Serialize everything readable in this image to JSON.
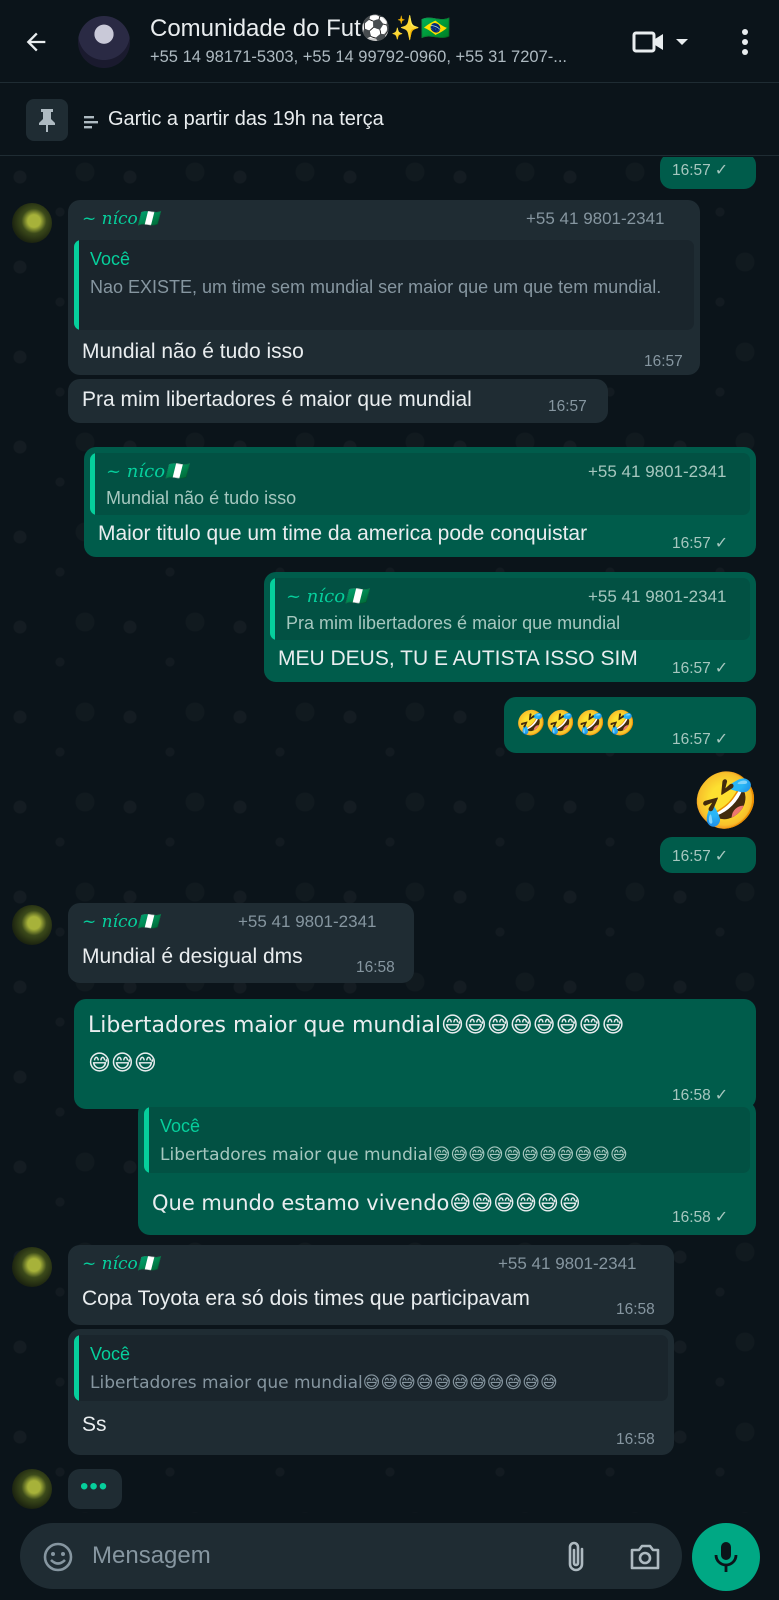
{
  "header": {
    "title": "Comunidade do Fut⚽✨🇧🇷",
    "subtitle": "+55 14 98171-5303, +55 14 99792-0960, +55 31 7207-..."
  },
  "pinned": {
    "text": "Gartic a partir das 19h na terça"
  },
  "messages": [
    {
      "time": "16:57"
    },
    {
      "sender": "~ níco🇳🇬",
      "phone": "+55 41 9801-2341",
      "quote_name": "Você",
      "quote_text": "Nao EXISTE, um time sem mundial ser maior que um que tem mundial.",
      "text": "Mundial não é tudo isso",
      "time": "16:57"
    },
    {
      "text": "Pra mim libertadores é maior que mundial",
      "time": "16:57"
    },
    {
      "quote_name": "~ níco🇳🇬",
      "quote_phone": "+55 41 9801-2341",
      "quote_text": "Mundial não é tudo isso",
      "text": "Maior titulo que um time da america pode conquistar",
      "time": "16:57"
    },
    {
      "quote_name": "~ níco🇳🇬",
      "quote_phone": "+55 41 9801-2341",
      "quote_text": "Pra mim libertadores é maior que mundial",
      "text": "MEU DEUS, TU E AUTISTA ISSO SIM",
      "time": "16:57"
    },
    {
      "text": "🤣🤣🤣🤣",
      "time": "16:57"
    },
    {
      "text": "🤣",
      "time": "16:57"
    },
    {
      "sender": "~ níco🇳🇬",
      "phone": "+55 41 9801-2341",
      "text": "Mundial é desigual dms",
      "time": "16:58"
    },
    {
      "text": "Libertadores maior que mundial😅😅😅😅😅😅😅😅",
      "text2": "😅😅😅",
      "time": "16:58"
    },
    {
      "quote_name": "Você",
      "quote_text": "Libertadores maior que mundial😅😅😅😅😅😅😅😅😅😅😅",
      "text": "Que mundo estamo vivendo😅😅😅😅😅😅",
      "time": "16:58"
    },
    {
      "sender": "~ níco🇳🇬",
      "phone": "+55 41 9801-2341",
      "text": "Copa Toyota era só dois times que participavam",
      "time": "16:58"
    },
    {
      "quote_name": "Você",
      "quote_text": "Libertadores maior que mundial😅😅😅😅😅😅😅😅😅😅😅",
      "text": "Ss",
      "time": "16:58"
    }
  ],
  "typing": "•••",
  "composer": {
    "placeholder": "Mensagem"
  },
  "icons": [
    "back-arrow-icon",
    "video-call-icon",
    "chevron-down-icon",
    "more-vert-icon",
    "pin-icon",
    "emoji-icon",
    "attach-icon",
    "camera-icon",
    "mic-icon",
    "check-icon"
  ],
  "colors": {
    "background": "#0b141a",
    "incoming": "#1f2c33",
    "outgoing": "#005c4b",
    "accent": "#00a884",
    "quote_name": "#06cf9c"
  }
}
